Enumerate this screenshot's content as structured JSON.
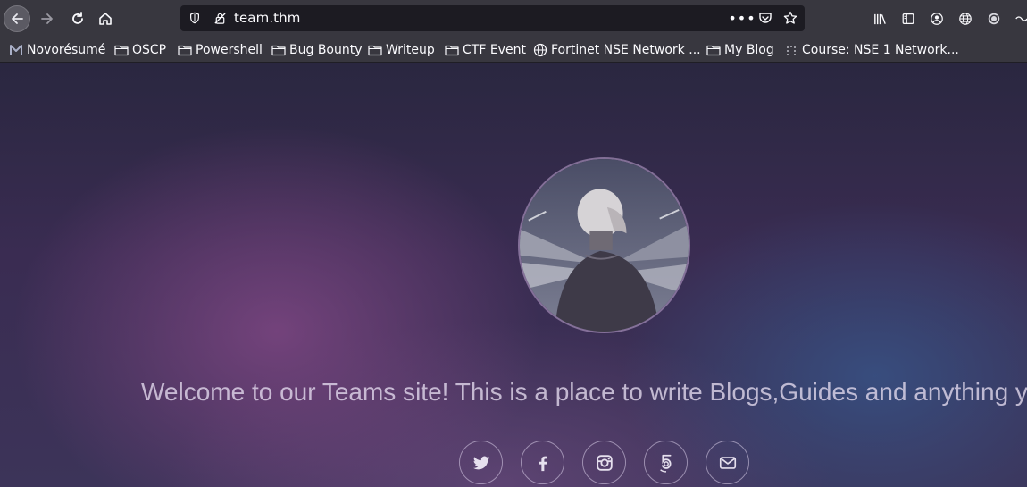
{
  "browser": {
    "url": "team.thm",
    "colors": {
      "toolbar": "#38373f",
      "urlbar": "#1c1b22"
    }
  },
  "bookmarks": [
    {
      "label": "Novorésumé",
      "icon": "novoresume-icon"
    },
    {
      "label": "OSCP",
      "icon": "folder-icon"
    },
    {
      "label": "Powershell",
      "icon": "folder-icon"
    },
    {
      "label": "Bug Bounty",
      "icon": "folder-icon"
    },
    {
      "label": "Writeup",
      "icon": "folder-icon"
    },
    {
      "label": "CTF Event",
      "icon": "folder-icon"
    },
    {
      "label": "Fortinet NSE Network ...",
      "icon": "globe-icon"
    },
    {
      "label": "My Blog",
      "icon": "folder-icon"
    },
    {
      "label": "Course: NSE 1 Network...",
      "icon": "dots-icon"
    }
  ],
  "page": {
    "welcome": "Welcome to our Teams site! This is a place to write Blogs,Guides and anything you",
    "social": [
      "twitter-icon",
      "facebook-icon",
      "instagram-icon",
      "500px-icon",
      "email-icon"
    ]
  }
}
